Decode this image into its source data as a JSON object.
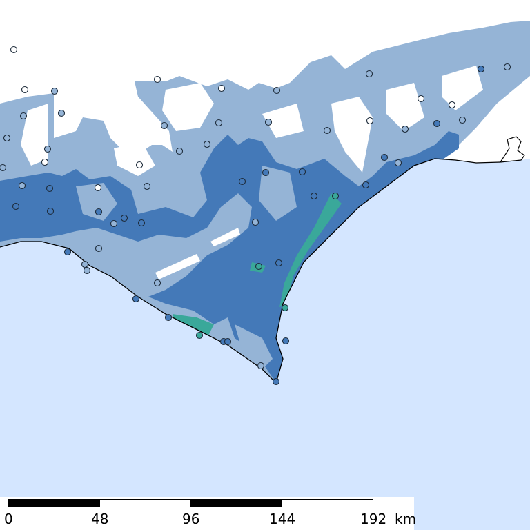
{
  "map": {
    "colors": {
      "ocean": "#d4e6ff",
      "land_unflooded": "#ffffff",
      "zone_light": "#95b4d6",
      "zone_medium": "#4479b8",
      "zone_high": "#3aa89a",
      "coastline": "#000000",
      "station_outline": "#1d2b3a"
    },
    "legend_icons": [
      "circle-marker-icon"
    ]
  },
  "scale_bar": {
    "unit": "km",
    "ticks": [
      "0",
      "48",
      "96",
      "144",
      "192"
    ]
  }
}
